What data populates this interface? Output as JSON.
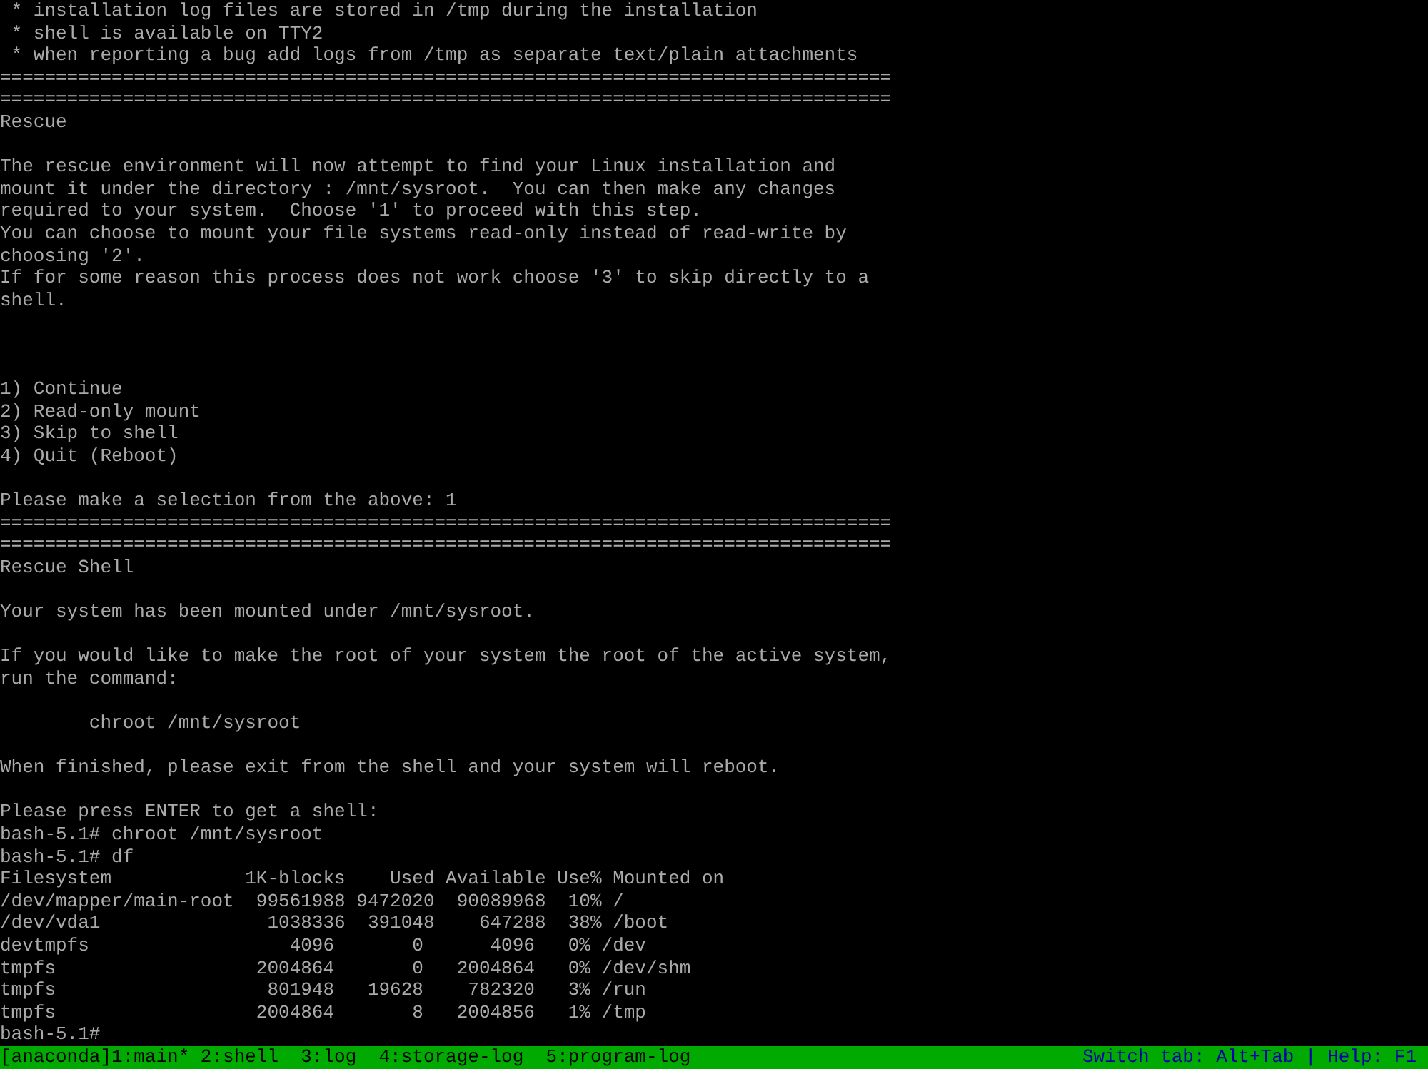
{
  "terminal": {
    "lines": [
      {
        "kind": "text",
        "text": " * installation log files are stored in /tmp during the installation"
      },
      {
        "kind": "text",
        "text": " * shell is available on TTY2"
      },
      {
        "kind": "text",
        "text": " * when reporting a bug add logs from /tmp as separate text/plain attachments"
      },
      {
        "kind": "text",
        "text": "================================================================================"
      },
      {
        "kind": "text",
        "text": "================================================================================"
      },
      {
        "kind": "text",
        "text": "Rescue"
      },
      {
        "kind": "blank"
      },
      {
        "kind": "text",
        "text": "The rescue environment will now attempt to find your Linux installation and"
      },
      {
        "kind": "text",
        "text": "mount it under the directory : /mnt/sysroot.  You can then make any changes"
      },
      {
        "kind": "text",
        "text": "required to your system.  Choose '1' to proceed with this step."
      },
      {
        "kind": "text",
        "text": "You can choose to mount your file systems read-only instead of read-write by"
      },
      {
        "kind": "text",
        "text": "choosing '2'."
      },
      {
        "kind": "text",
        "text": "If for some reason this process does not work choose '3' to skip directly to a"
      },
      {
        "kind": "text",
        "text": "shell."
      },
      {
        "kind": "blank"
      },
      {
        "kind": "blank"
      },
      {
        "kind": "blank"
      },
      {
        "kind": "text",
        "text": "1) Continue"
      },
      {
        "kind": "text",
        "text": "2) Read-only mount"
      },
      {
        "kind": "text",
        "text": "3) Skip to shell"
      },
      {
        "kind": "text",
        "text": "4) Quit (Reboot)"
      },
      {
        "kind": "blank"
      },
      {
        "kind": "text",
        "text": "Please make a selection from the above: 1"
      },
      {
        "kind": "text",
        "text": "================================================================================"
      },
      {
        "kind": "text",
        "text": "================================================================================"
      },
      {
        "kind": "text",
        "text": "Rescue Shell"
      },
      {
        "kind": "blank"
      },
      {
        "kind": "text",
        "text": "Your system has been mounted under /mnt/sysroot."
      },
      {
        "kind": "blank"
      },
      {
        "kind": "text",
        "text": "If you would like to make the root of your system the root of the active system,"
      },
      {
        "kind": "text",
        "text": "run the command:"
      },
      {
        "kind": "blank"
      },
      {
        "kind": "text",
        "text": "        chroot /mnt/sysroot"
      },
      {
        "kind": "blank"
      },
      {
        "kind": "text",
        "text": "When finished, please exit from the shell and your system will reboot."
      },
      {
        "kind": "blank"
      },
      {
        "kind": "text",
        "text": "Please press ENTER to get a shell:"
      },
      {
        "kind": "text",
        "text": "bash-5.1# chroot /mnt/sysroot"
      },
      {
        "kind": "text",
        "text": "bash-5.1# df"
      },
      {
        "kind": "text",
        "text": "Filesystem            1K-blocks    Used Available Use% Mounted on"
      },
      {
        "kind": "text",
        "text": "/dev/mapper/main-root  99561988 9472020  90089968  10% /"
      },
      {
        "kind": "text",
        "text": "/dev/vda1               1038336  391048    647288  38% /boot"
      },
      {
        "kind": "text",
        "text": "devtmpfs                  4096       0      4096   0% /dev"
      },
      {
        "kind": "text",
        "text": "tmpfs                  2004864       0   2004864   0% /dev/shm"
      },
      {
        "kind": "text",
        "text": "tmpfs                   801948   19628    782320   3% /run"
      },
      {
        "kind": "text",
        "text": "tmpfs                  2004864       8   2004856   1% /tmp"
      },
      {
        "kind": "text",
        "text": "bash-5.1#"
      }
    ]
  },
  "status_bar": {
    "windows": "[anaconda]1:main* 2:shell  3:log  4:storage-log  5:program-log",
    "hint": "Switch tab: Alt+Tab | Help: F1"
  }
}
